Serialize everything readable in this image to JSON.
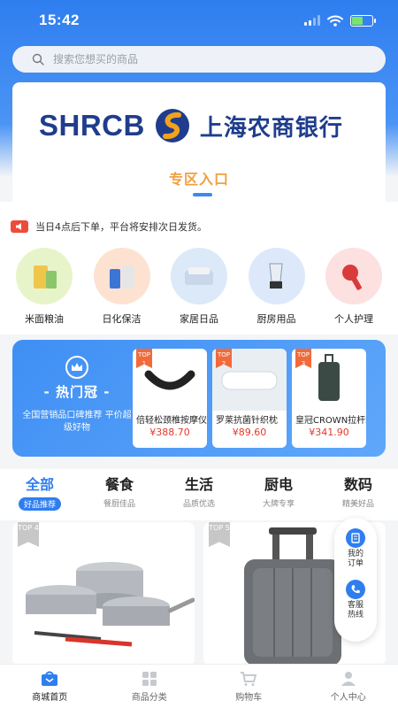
{
  "status_bar": {
    "time": "15:42"
  },
  "search": {
    "placeholder": "搜索您想买的商品"
  },
  "banner": {
    "bank_en": "SHRCB",
    "bank_cn": "上海农商银行",
    "zone_entry": "专区入口"
  },
  "notice": {
    "text": "当日4点后下单，平台将安排次日发货。"
  },
  "categories": [
    {
      "label": "米面粮油",
      "color": "#e7f4c9"
    },
    {
      "label": "日化保洁",
      "color": "#fde2d2"
    },
    {
      "label": "家居日品",
      "color": "#dbe9f8"
    },
    {
      "label": "厨房用品",
      "color": "#dde9fb"
    },
    {
      "label": "个人护理",
      "color": "#fde0e0"
    }
  ],
  "hot": {
    "title": "- 热门冠 -",
    "subtitle": "全国营销品口碑推荐 平价超级好物",
    "items": [
      {
        "top": "TOP 1",
        "name": "倍轻松颈椎按摩仪",
        "price": "¥388.70"
      },
      {
        "top": "TOP 2",
        "name": "罗莱抗菌针织枕",
        "price": "¥89.60"
      },
      {
        "top": "TOP 3",
        "name": "皇冠CROWN拉杆箱",
        "price": "¥341.90"
      }
    ]
  },
  "tabs": [
    {
      "name": "全部",
      "sub": "好品推荐",
      "active": true
    },
    {
      "name": "餐食",
      "sub": "餐厨佳品",
      "active": false
    },
    {
      "name": "生活",
      "sub": "品质优选",
      "active": false
    },
    {
      "name": "厨电",
      "sub": "大牌专享",
      "active": false
    },
    {
      "name": "数码",
      "sub": "精美好品",
      "active": false
    }
  ],
  "products": [
    {
      "top": "TOP 4"
    },
    {
      "top": "TOP 5"
    }
  ],
  "float_panel": {
    "orders": "我的订单",
    "hotline": "客服热线"
  },
  "bottom_nav": [
    {
      "label": "商城首页",
      "icon": "shop-bag-icon",
      "active": true
    },
    {
      "label": "商品分类",
      "icon": "grid-icon",
      "active": false
    },
    {
      "label": "购物车",
      "icon": "cart-icon",
      "active": false
    },
    {
      "label": "个人中心",
      "icon": "person-icon",
      "active": false
    }
  ],
  "colors": {
    "primary": "#2f7ef0",
    "price": "#e4392b",
    "accent": "#f0a040"
  }
}
